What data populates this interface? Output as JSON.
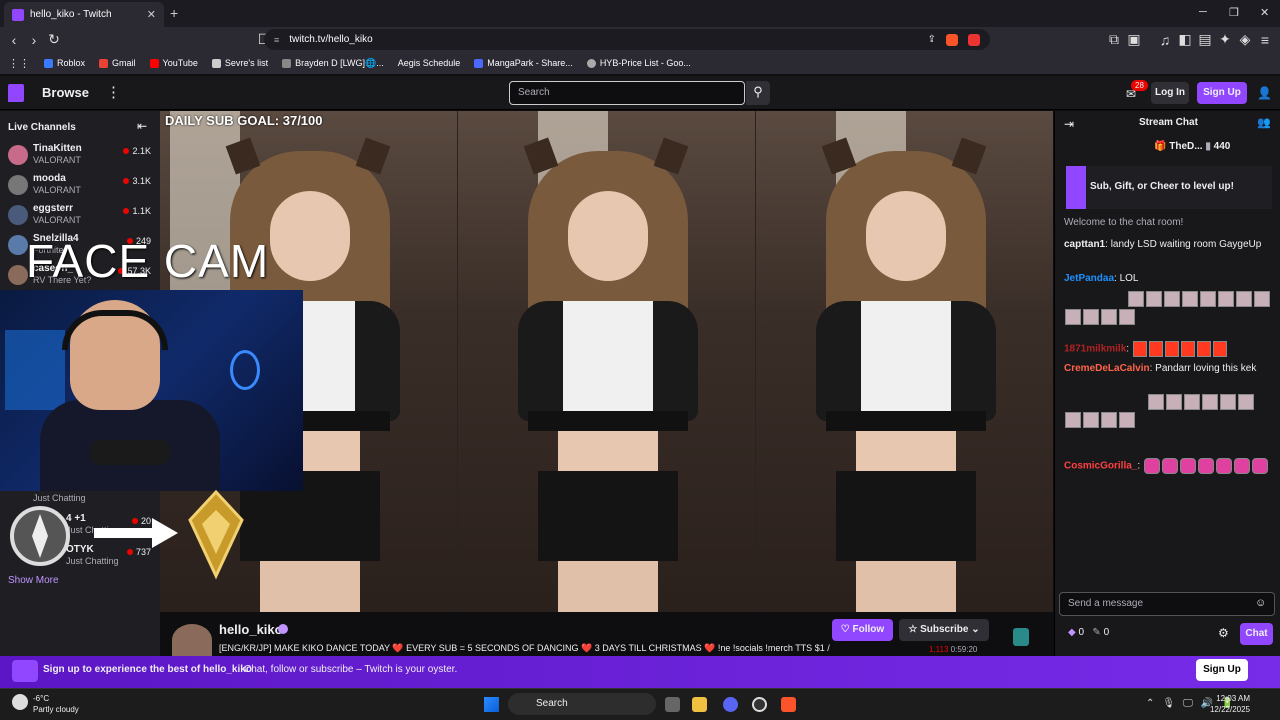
{
  "browser": {
    "tab_title": "hello_kiko - Twitch",
    "new_tab": "+",
    "url": "twitch.tv/hello_kiko",
    "bookmarks": [
      "Roblox",
      "Gmail",
      "YouTube",
      "Sevre's list",
      "Brayden D [LWG]🌐...",
      "Aegis Schedule",
      "MangaPark - Share...",
      "HYB-Price List - Goo..."
    ]
  },
  "topnav": {
    "browse": "Browse",
    "search_placeholder": "Search",
    "notification_count": "28",
    "login": "Log In",
    "signup": "Sign Up"
  },
  "sidebar": {
    "title": "Live Channels",
    "channels": [
      {
        "name": "TinaKitten",
        "game": "VALORANT",
        "viewers": "2.1K"
      },
      {
        "name": "mooda",
        "game": "VALORANT",
        "viewers": "3.1K"
      },
      {
        "name": "eggsterr",
        "game": "VALORANT",
        "viewers": "1.1K"
      },
      {
        "name": "Snelzilla4",
        "game": "Fortnite",
        "viewers": "249"
      },
      {
        "name": "caseoh_",
        "game": "RV There Yet?",
        "viewers": "57.3K"
      }
    ],
    "partial_rows": [
      {
        "game": "Just Chatting",
        "viewers": ""
      },
      {
        "name": "4 +1",
        "game": "Just Chatting",
        "viewers": "20"
      },
      {
        "name": "OTYK",
        "game": "Just Chatting",
        "viewers": "737"
      }
    ],
    "show_more": "Show More"
  },
  "video": {
    "sub_goal": "DAILY SUB GOAL: 37/100",
    "facecam_label": "FACE CAM"
  },
  "stream_info": {
    "streamer": "hello_kiko",
    "title": "[ENG/KR/JP] MAKE KIKO DANCE TODAY ❤️ EVERY SUB = 5 SECONDS OF DANCING ❤️ 3 DAYS TILL CHRISTMAS ❤️ !ne !socials !merch TTS $1 /",
    "viewers": "1,113",
    "uptime": "0:59:20",
    "follow": "Follow",
    "subscribe": "Subscribe"
  },
  "chat": {
    "title": "Stream Chat",
    "leader_name": "TheD...",
    "leader_amount": "440",
    "promo": "Sub, Gift, or Cheer to level up!",
    "welcome": "Welcome to the chat room!",
    "messages": [
      {
        "user": "capttan1",
        "user_color": "#ffffff",
        "text": "landy LSD waiting room GaygeUp"
      },
      {
        "user": "JetPandaa",
        "user_color": "#1e90ff",
        "text": "LOL"
      },
      {
        "user": "",
        "user_color": "#3a3aff",
        "text": ""
      },
      {
        "user": "1871milkmilk",
        "user_color": "#b22222",
        "text": ""
      },
      {
        "user": "CremeDeLaCalvin",
        "user_color": "#ff6347",
        "text": "Pandarr loving this kek"
      },
      {
        "user": "",
        "user_color": "#3a3aff",
        "text": ""
      },
      {
        "user": "CosmicGorilla_",
        "user_color": "#ff4040",
        "text": ""
      }
    ],
    "input_placeholder": "Send a message",
    "points": "0",
    "bits": "0",
    "send": "Chat"
  },
  "banner": {
    "bold": "Sign up to experience the best of hello_kiko",
    "text": "Chat, follow or subscribe – Twitch is your oyster.",
    "signup": "Sign Up"
  },
  "taskbar": {
    "temp": "-6°C",
    "weather": "Partly cloudy",
    "search": "Search",
    "time": "12:03 AM",
    "date": "12/22/2025"
  },
  "colors": {
    "twitch_purple": "#9146ff",
    "live_red": "#eb0400"
  }
}
